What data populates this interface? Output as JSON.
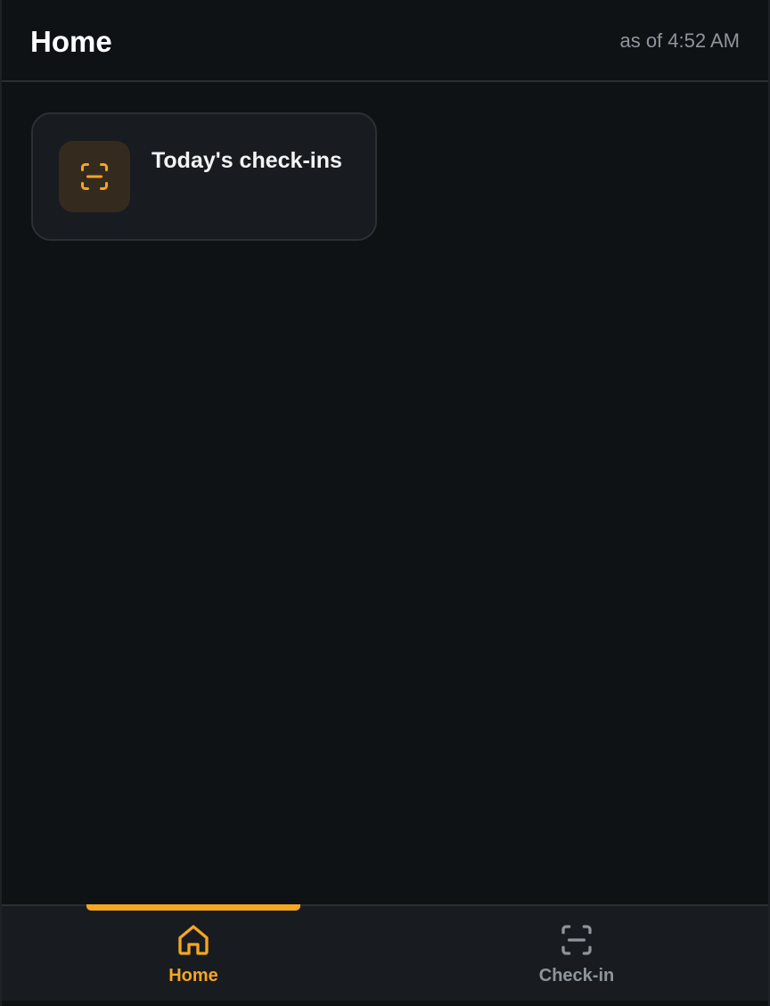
{
  "header": {
    "title": "Home",
    "as_of": "as of 4:52 AM"
  },
  "cards": [
    {
      "label": "Today's check-ins",
      "icon": "scan-icon"
    }
  ],
  "nav": {
    "items": [
      {
        "label": "Home",
        "icon": "home-icon",
        "active": true
      },
      {
        "label": "Check-in",
        "icon": "scan-icon",
        "active": false
      }
    ]
  },
  "colors": {
    "accent": "#f5a623",
    "background": "#0f1215",
    "surface": "#181c20",
    "muted_text": "#8e959c"
  }
}
